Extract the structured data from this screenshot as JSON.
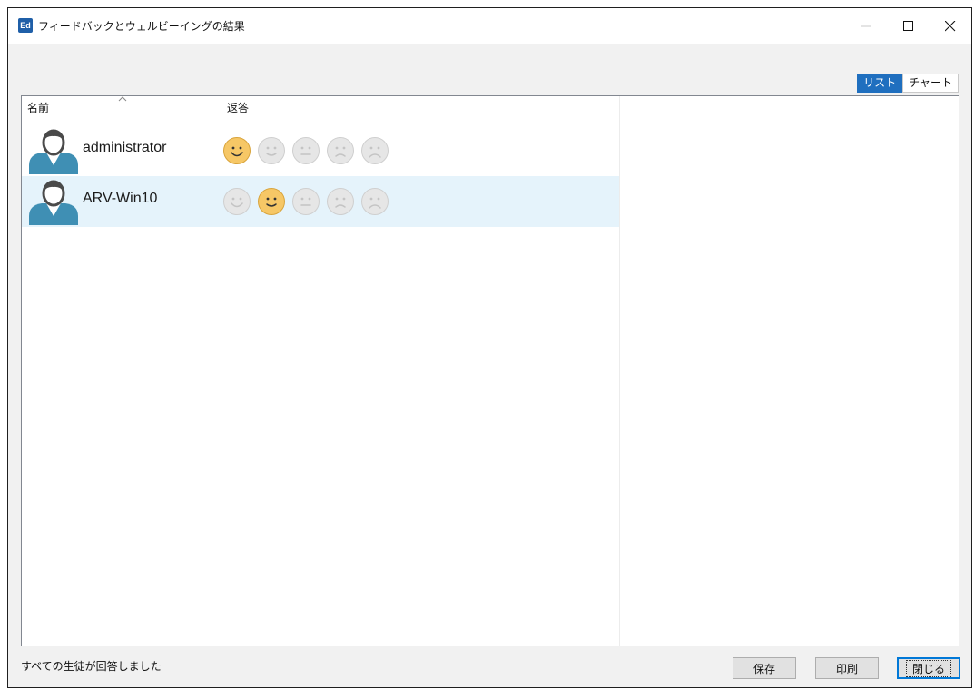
{
  "window": {
    "title": "フィードバックとウェルビーイングの結果",
    "app_icon_label": "Ed"
  },
  "view_toggle": {
    "list_label": "リスト",
    "chart_label": "チャート",
    "active": "list"
  },
  "table": {
    "columns": {
      "name": "名前",
      "response": "返答"
    },
    "rows": [
      {
        "name": "administrator",
        "selected_face": 0,
        "highlighted": false
      },
      {
        "name": "ARV-Win10",
        "selected_face": 1,
        "highlighted": true
      }
    ]
  },
  "footer": {
    "status": "すべての生徒が回答しました",
    "save_label": "保存",
    "print_label": "印刷",
    "close_label": "閉じる"
  },
  "colors": {
    "accent": "#1f6fbf",
    "face_selected": "#f6c766",
    "face_inactive": "#e6e6e6",
    "avatar": "#3f8fb4",
    "avatar_head": "#4a4a4a"
  },
  "icons": {
    "faces": [
      "very-happy-face-icon",
      "happy-face-icon",
      "neutral-face-icon",
      "sad-face-icon",
      "very-sad-face-icon"
    ]
  }
}
